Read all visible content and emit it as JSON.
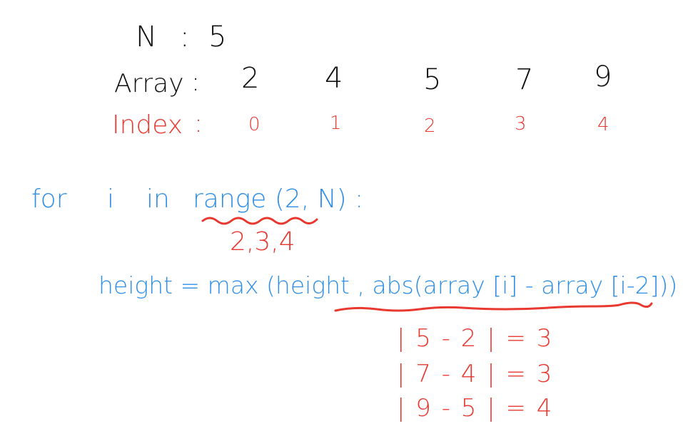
{
  "n_line": {
    "label": "N",
    "colon": ":",
    "value": "5"
  },
  "array_line": {
    "label": "Array",
    "colon": ":",
    "values": [
      "2",
      "4",
      "5",
      "7",
      "9"
    ]
  },
  "index_line": {
    "label": "Index",
    "colon": ":",
    "values": [
      "0",
      "1",
      "2",
      "3",
      "4"
    ]
  },
  "for_line": {
    "keyword_for": "for",
    "var": "i",
    "keyword_in": "in",
    "range_call": "range (2, N) :"
  },
  "range_values": "2,3,4",
  "height_line": {
    "text": "height = max (height , abs(array [i] - array [i-2]))"
  },
  "calculations": [
    "| 5  -  2 | = 3",
    "| 7  -  4 | = 3",
    "| 9  -  5 | = 4"
  ],
  "colors": {
    "black": "#111111",
    "red": "#e8382f",
    "blue": "#2e8fe6"
  }
}
